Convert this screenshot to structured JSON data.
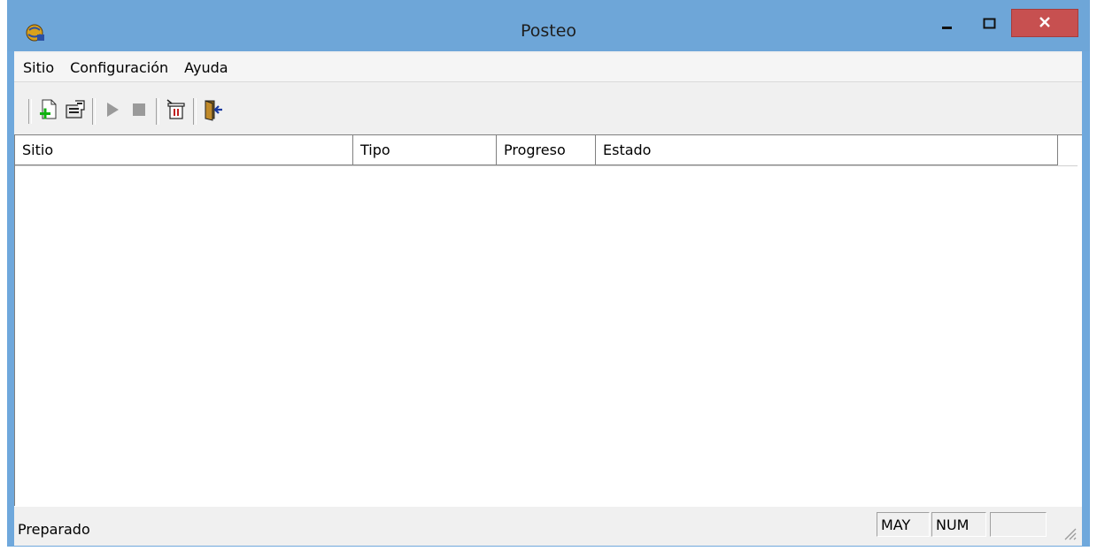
{
  "window": {
    "title": "Posteo",
    "app_icon": "app-globe-icon",
    "titlebar_color": "#6ea6d8",
    "close_color": "#c75050",
    "controls": {
      "minimize_icon": "minimize-icon",
      "maximize_icon": "maximize-icon",
      "close_icon": "close-icon"
    }
  },
  "menu": {
    "items": [
      {
        "label": "Sitio"
      },
      {
        "label": "Configuración"
      },
      {
        "label": "Ayuda"
      }
    ]
  },
  "toolbar": {
    "buttons": [
      {
        "icon": "new-site-icon"
      },
      {
        "icon": "properties-icon"
      },
      {
        "icon": "play-icon"
      },
      {
        "icon": "stop-icon"
      },
      {
        "icon": "clear-log-icon"
      },
      {
        "icon": "exit-icon"
      }
    ]
  },
  "list": {
    "columns": [
      {
        "label": "Sitio"
      },
      {
        "label": "Tipo"
      },
      {
        "label": "Progreso"
      },
      {
        "label": "Estado"
      }
    ],
    "rows": []
  },
  "status": {
    "text": "Preparado",
    "indicators": [
      {
        "label": "MAY"
      },
      {
        "label": "NUM"
      },
      {
        "label": ""
      }
    ]
  }
}
